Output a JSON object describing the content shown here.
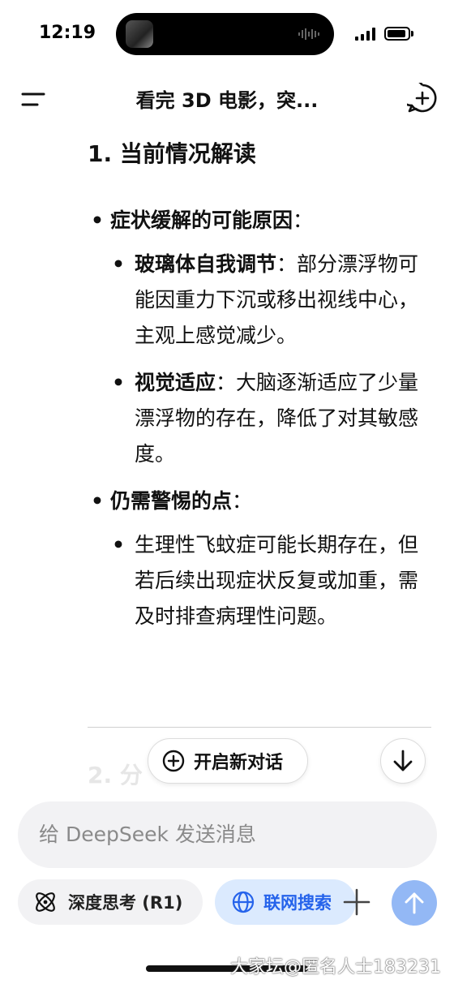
{
  "status_bar": {
    "time": "12:19"
  },
  "header": {
    "title": "看完 3D 电影，突..."
  },
  "content": {
    "section_heading": "1. 当前情况解读",
    "bullet_1": {
      "title": "症状缓解的可能原因",
      "colon": "：",
      "items": [
        {
          "bold": "玻璃体自我调节",
          "text": "：部分漂浮物可能因重力下沉或移出视线中心，主观上感觉减少。"
        },
        {
          "bold": "视觉适应",
          "text": "：大脑逐渐适应了少量漂浮物的存在，降低了对其敏感度。"
        }
      ]
    },
    "bullet_2": {
      "title": "仍需警惕的点",
      "colon": "：",
      "items": [
        {
          "text": "生理性飞蚊症可能长期存在，但若后续出现症状反复或加重，需及时排查病理性问题。"
        }
      ]
    },
    "next_heading_fragment": "2. 分"
  },
  "floating": {
    "new_chat_label": "开启新对话"
  },
  "composer": {
    "placeholder": "给 DeepSeek 发送消息",
    "deep_think_label": "深度思考 (R1)",
    "web_search_label": "联网搜索"
  },
  "colors": {
    "accent": "#2563eb",
    "send_button": "#93b8f5",
    "search_pill_bg": "#dbeafe"
  },
  "watermark": "大家坛@匿名人士183231"
}
